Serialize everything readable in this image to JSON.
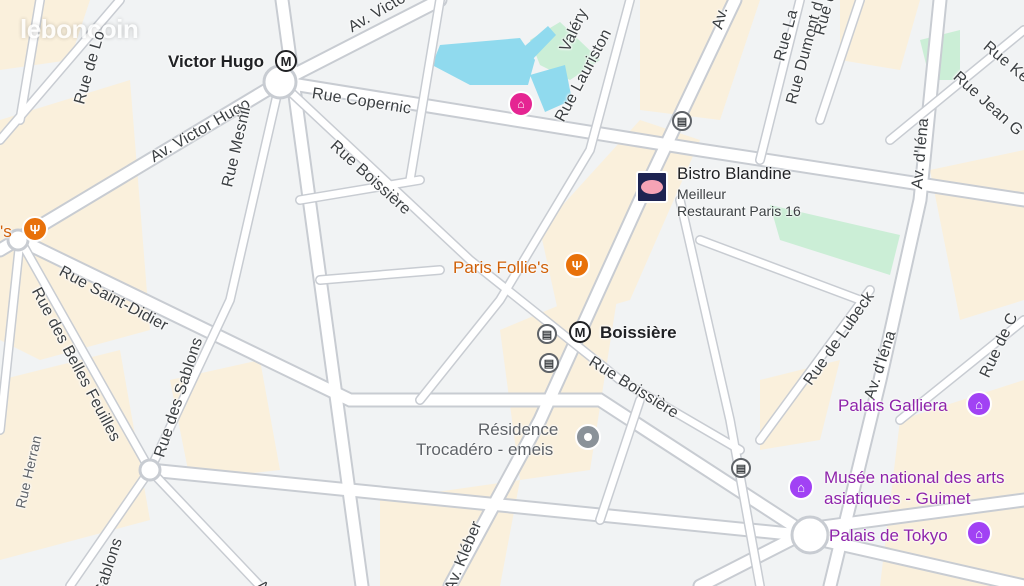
{
  "watermark": "leboncoin",
  "stations": {
    "victor_hugo": "Victor Hugo",
    "boissiere": "Boissière",
    "metro_glyph": "M"
  },
  "streets": {
    "av_victor_hugo_top": "Av. Victo",
    "rue_de_longchamp": "Rue de Lo",
    "rue_copernic": "Rue Copernic",
    "rue_lauriston": "Rue Lauriston",
    "rue_valery": "Valéry",
    "av_victor_hugo": "Av. Victor Hugo",
    "rue_mesnil": "Rue Mesnil",
    "rue_boissiere_1": "Rue Boissière",
    "rue_boissiere_2": "Rue Boissière",
    "rue_saint_didier": "Rue Saint-Didier",
    "rue_des_belles_feuilles": "Rue des Belles Feuilles",
    "rue_des_sablons": "Rue des Sablons",
    "rue_herran": "Rue Herran",
    "sablons": "Sablons",
    "av_kleber": "Av. Kléber",
    "av_top": "Av.",
    "rue_la": "Rue La",
    "rue_dumont": "Rue Dumont d",
    "rue_ke": "Rue Ke",
    "rue_jean": "Rue Jean G",
    "av_iena_1": "Av. d'Iéna",
    "av_iena_2": "Av. d'Iéna",
    "rue_de_lubeck": "Rue de Lubeck",
    "rue_de_c": "Rue de C",
    "av_bottom_left": "Av",
    "rue_de_top": "Rue de"
  },
  "pois": {
    "bistro_title": "Bistro Blandine",
    "bistro_sub1": "Meilleur",
    "bistro_sub2": "Restaurant Paris 16",
    "paris_follies": "Paris Follie's",
    "left_restaurant": "'s",
    "residence_1": "Résidence",
    "residence_2": "Trocadéro - emeis",
    "palais_galliera": "Palais Galliera",
    "musee_1": "Musée national des arts",
    "musee_2": "asiatiques - Guimet",
    "palais_tokyo": "Palais de Tokyo"
  },
  "icons": {
    "restaurant": "fork-knife-icon",
    "hotel": "bed-icon",
    "museum": "museum-icon",
    "bus": "bus-icon",
    "metro": "metro-icon",
    "place": "place-icon"
  },
  "colors": {
    "background": "#f1f3f4",
    "road": "#ffffff",
    "road_outline": "#c8ccd2",
    "block": "#faf0dc",
    "park": "#cbeed6",
    "water": "#90daee",
    "restaurant": "#e8710a",
    "museum": "#a142f4",
    "hotel": "#e52592",
    "text": "#3c4043"
  }
}
